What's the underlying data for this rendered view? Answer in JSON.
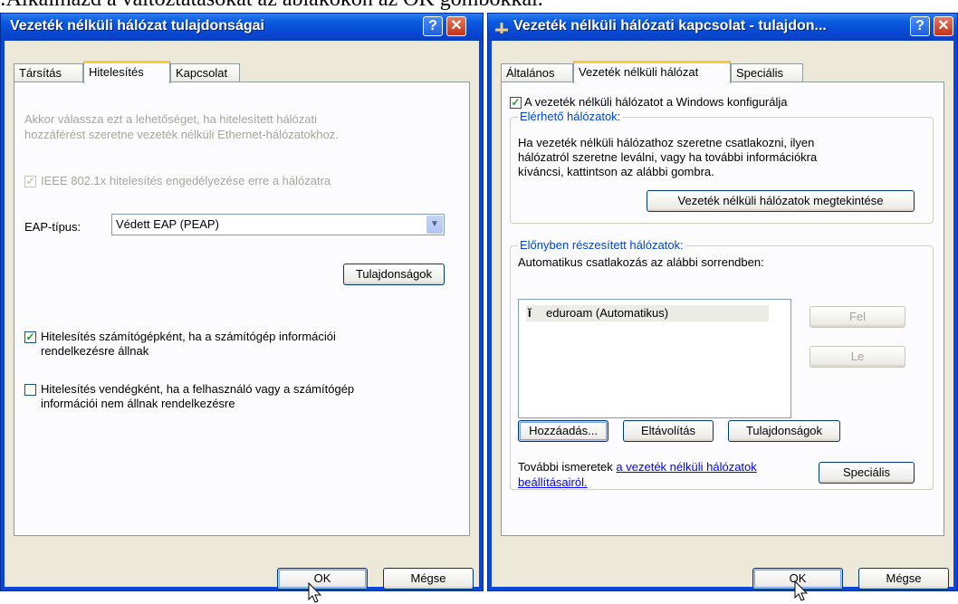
{
  "caption": ":Alkalmazd a változtatásokat az ablakokon az OK gombokkal.",
  "left_window": {
    "title": "Vezeték nélküli hálózat tulajdonságai",
    "tabs": [
      "Társítás",
      "Hitelesítés",
      "Kapcsolat"
    ],
    "active_tab": "Hitelesítés",
    "info_line1": "Akkor válassza ezt a lehetőséget, ha hitelesített hálózati",
    "info_line2": "hozzáférést szeretne vezeték nélküli Ethernet-hálózatokhoz.",
    "ieee_checkbox": {
      "label": "IEEE 802.1x hitelesítés engedélyezése erre a hálózatra",
      "checked": true,
      "enabled": false
    },
    "eap_label": "EAP-típus:",
    "eap_value": "Védett EAP (PEAP)",
    "properties_button": "Tulajdonságok",
    "computer_auth": {
      "line1": "Hitelesítés számítógépként, ha a számítógép információi",
      "line2": "rendelkezésre állnak",
      "checked": true
    },
    "guest_auth": {
      "line1": "Hitelesítés vendégként, ha a felhasználó vagy a számítógép",
      "line2": "információi nem állnak rendelkezésre",
      "checked": false
    },
    "ok_button": "OK",
    "cancel_button": "Mégse"
  },
  "right_window": {
    "title": "Vezeték nélküli hálózati kapcsolat - tulajdon...",
    "tabs": [
      "Általános",
      "Vezeték nélküli hálózat",
      "Speciális"
    ],
    "active_tab": "Vezeték nélküli hálózat",
    "windows_config": {
      "label": "A vezeték nélküli hálózatot a Windows konfigurálja",
      "checked": true
    },
    "available": {
      "legend": "Elérhető hálózatok:",
      "line1": "Ha vezeték nélküli hálózathoz szeretne csatlakozni, ilyen",
      "line2": "hálózatról szeretne leválni, vagy ha további információkra",
      "line3": "kíváncsi, kattintson az alábbi gombra.",
      "view_button": "Vezeték nélküli hálózatok megtekintése"
    },
    "preferred": {
      "legend": "Előnyben részesített hálózatok:",
      "description": "Automatikus csatlakozás az alábbi sorrendben:",
      "networks": [
        "eduroam (Automatikus)"
      ],
      "up_button": "Fel",
      "down_button": "Le",
      "add_button": "Hozzáadás...",
      "remove_button": "Eltávolítás",
      "properties_button": "Tulajdonságok",
      "more_info_text": "További ismeretek",
      "more_info_link1": "a vezeték nélküli hálózatok",
      "more_info_link2": "beállításairól.",
      "advanced_button": "Speciális"
    },
    "ok_button": "OK",
    "cancel_button": "Mégse"
  },
  "colors": {
    "title_bar": "#0a5be0",
    "dialog_bg": "#ece9d8",
    "tab_accent": "#ffc83c",
    "group_label": "#0046d5",
    "check_mark": "#21a121"
  },
  "icons": {
    "help": "question-mark-icon",
    "close": "close-x-icon",
    "network": "wireless-network-icon",
    "cursor": "mouse-pointer-icon"
  }
}
